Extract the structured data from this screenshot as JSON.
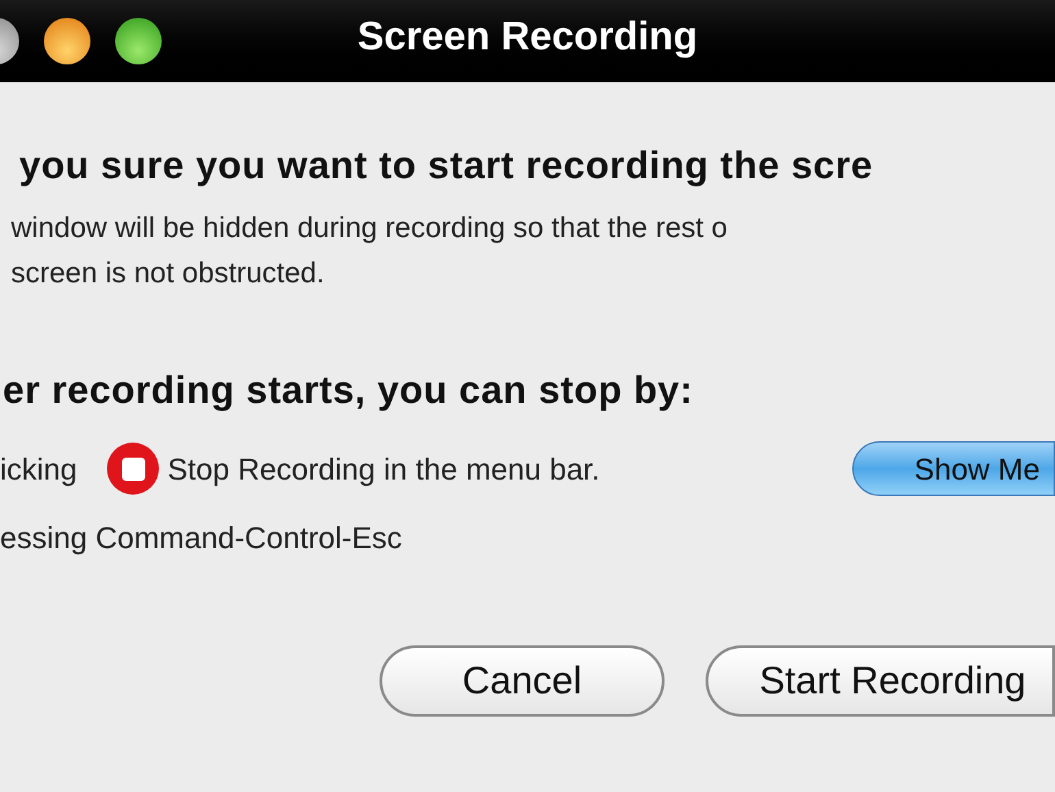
{
  "window": {
    "title": "Screen Recording"
  },
  "heading": "you sure you want to start recording the scre",
  "message_lines": [
    "window will be hidden during recording so that the rest o",
    "screen is not obstructed."
  ],
  "stop_heading": "er recording starts, you can stop by:",
  "stop_options": [
    {
      "kind": "menu",
      "prefix": "icking",
      "text": "Stop Recording in the menu bar.",
      "button": "Show Me"
    },
    {
      "kind": "keys",
      "text": "essing Command-Control-Esc"
    }
  ],
  "buttons": [
    {
      "label": "Cancel",
      "default": false
    },
    {
      "label": "Start Recording",
      "default": false
    }
  ]
}
